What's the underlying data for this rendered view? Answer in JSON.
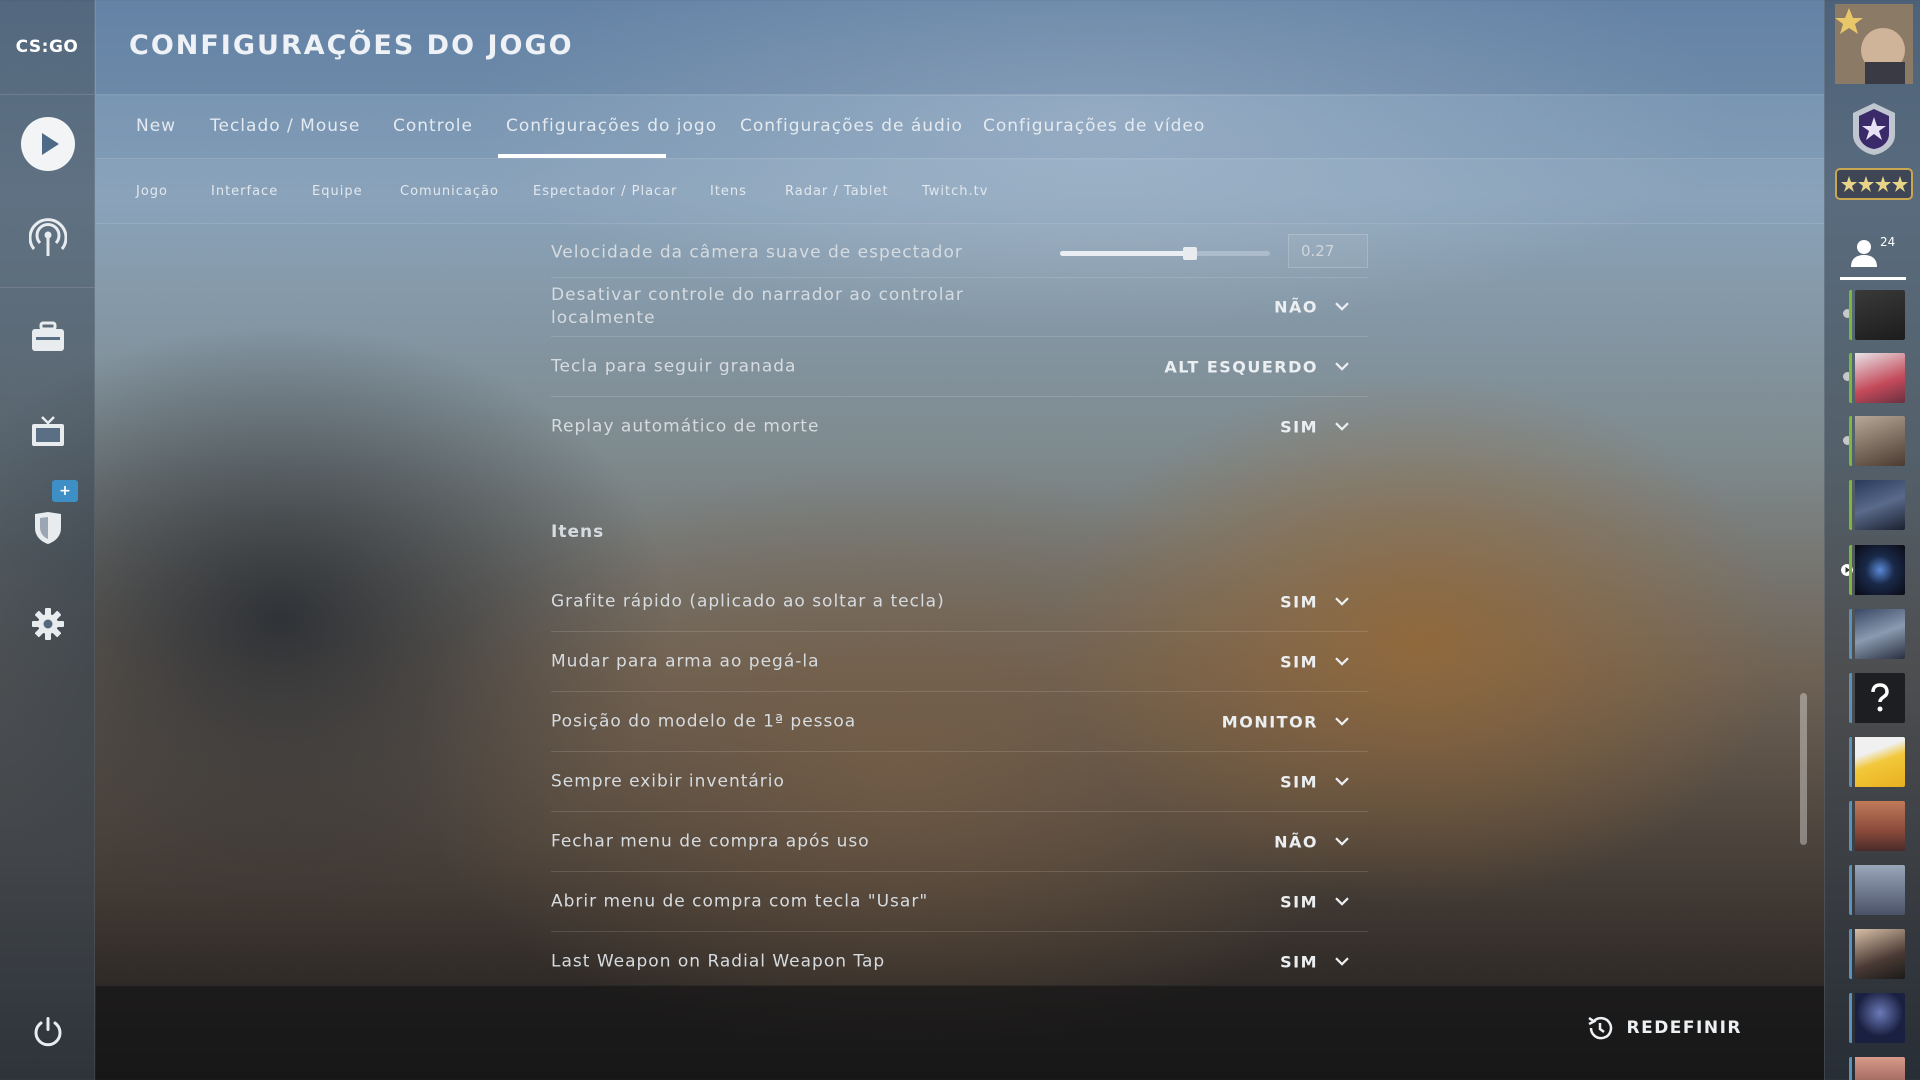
{
  "app": {
    "logo": "CS:GO",
    "page_title": "CONFIGURAÇÕES DO JOGO"
  },
  "tabs": [
    {
      "label": "New"
    },
    {
      "label": "Teclado / Mouse"
    },
    {
      "label": "Controle"
    },
    {
      "label": "Configurações do jogo",
      "active": true
    },
    {
      "label": "Configurações de áudio"
    },
    {
      "label": "Configurações de vídeo"
    }
  ],
  "subtabs": [
    {
      "label": "Jogo"
    },
    {
      "label": "Interface"
    },
    {
      "label": "Equipe"
    },
    {
      "label": "Comunicação"
    },
    {
      "label": "Espectador / Placar"
    },
    {
      "label": "Itens"
    },
    {
      "label": "Radar / Tablet"
    },
    {
      "label": "Twitch.tv"
    }
  ],
  "left_nav": [
    {
      "icon": "play-icon"
    },
    {
      "icon": "broadcast-icon"
    },
    {
      "icon": "inventory-icon"
    },
    {
      "icon": "tv-icon"
    },
    {
      "icon": "shield-icon",
      "badge": "+"
    },
    {
      "icon": "gear-icon"
    },
    {
      "icon": "power-icon"
    }
  ],
  "spectator_rows": {
    "camera_speed": {
      "label": "Velocidade da câmera suave de espectador",
      "value": "0.27",
      "fraction": 0.62
    },
    "narrator": {
      "label": "Desativar controle do narrador ao controlar localmente",
      "value": "NÃO"
    },
    "grenade_key": {
      "label": "Tecla para seguir granada",
      "value": "ALT ESQUERDO"
    },
    "death_replay": {
      "label": "Replay automático de morte",
      "value": "SIM"
    }
  },
  "items_section": {
    "title": "Itens",
    "rows": [
      {
        "label": "Grafite rápido (aplicado ao soltar a tecla)",
        "value": "SIM"
      },
      {
        "label": "Mudar para arma ao pegá-la",
        "value": "SIM"
      },
      {
        "label": "Posição do modelo de 1ª pessoa",
        "value": "MONITOR"
      },
      {
        "label": "Sempre exibir inventário",
        "value": "SIM"
      },
      {
        "label": "Fechar menu de compra após uso",
        "value": "NÃO"
      },
      {
        "label": "Abrir menu de compra com tecla \"Usar\"",
        "value": "SIM"
      },
      {
        "label": "Last Weapon on Radial Weapon Tap",
        "value": "SIM"
      }
    ]
  },
  "footer": {
    "reset_label": "REDEFINIR"
  },
  "right_panel": {
    "friends_count": "24",
    "colors": {
      "online": "#7ab83f",
      "offline": "#5e91b5"
    }
  }
}
